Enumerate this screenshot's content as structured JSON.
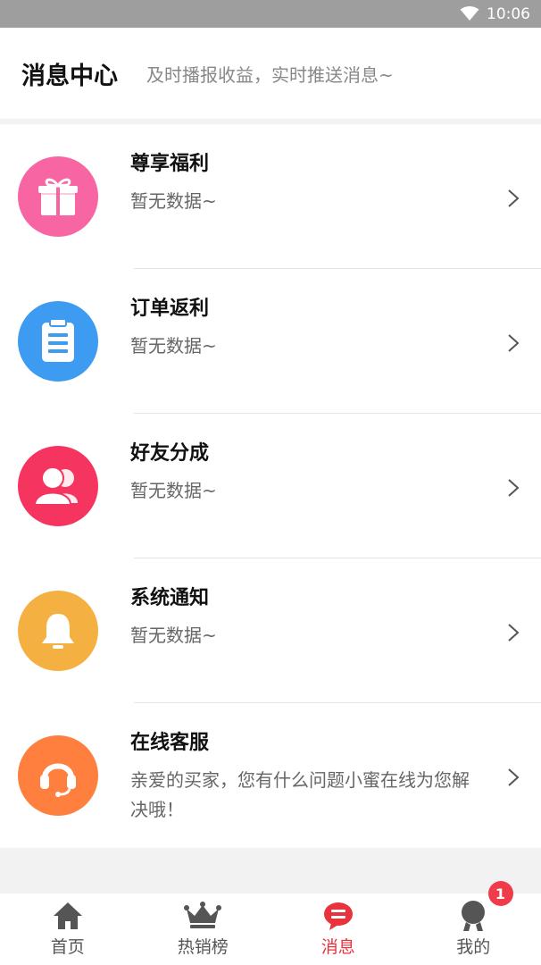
{
  "status_bar": {
    "time": "10:06",
    "wifi_icon": "wifi-icon"
  },
  "header": {
    "title": "消息中心",
    "subtitle": "及时播报收益，实时推送消息~"
  },
  "messages": [
    {
      "title": "尊享福利",
      "desc": "暂无数据~",
      "icon": "gift-icon",
      "color": "#f765a3"
    },
    {
      "title": "订单返利",
      "desc": "暂无数据~",
      "icon": "clipboard-icon",
      "color": "#3d9cf2"
    },
    {
      "title": "好友分成",
      "desc": "暂无数据~",
      "icon": "friends-icon",
      "color": "#f5355f"
    },
    {
      "title": "系统通知",
      "desc": "暂无数据~",
      "icon": "bell-icon",
      "color": "#f4b142"
    },
    {
      "title": "在线客服",
      "desc": "亲爱的买家，您有什么问题小蜜在线为您解决哦！",
      "icon": "headset-icon",
      "color": "#ff7f3e"
    }
  ],
  "tabbar": {
    "home": "首页",
    "hot": "热销榜",
    "messages": "消息",
    "mine": "我的",
    "mine_badge": "1",
    "active_color": "#e8323c",
    "inactive_color": "#555555"
  }
}
